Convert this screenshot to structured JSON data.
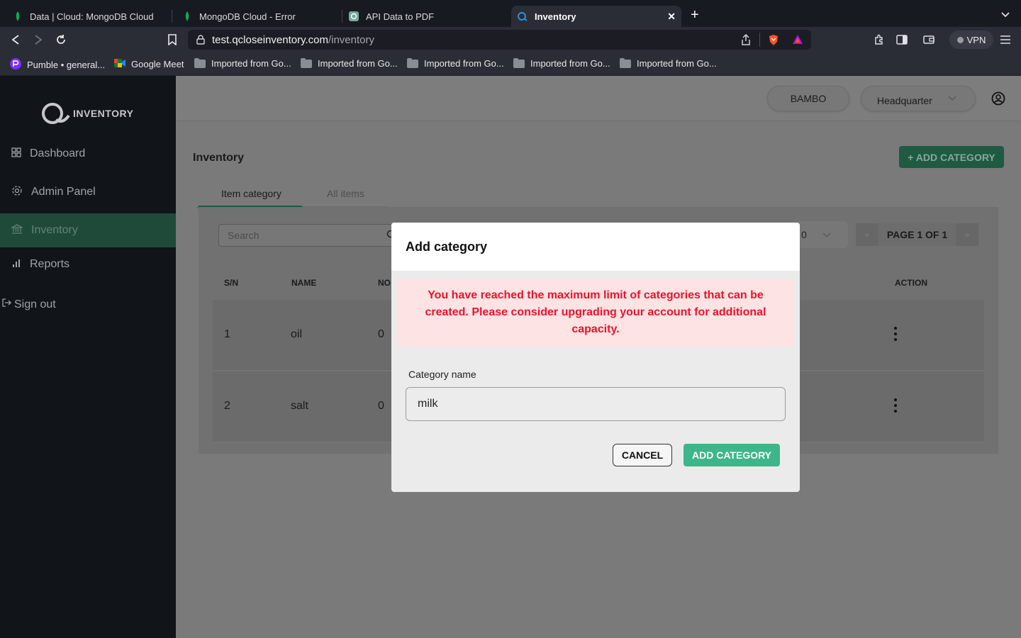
{
  "browser": {
    "tabs": [
      {
        "title": "Data | Cloud: MongoDB Cloud",
        "icon": "mongodb-leaf-icon"
      },
      {
        "title": "MongoDB Cloud - Error",
        "icon": "mongodb-leaf-icon"
      },
      {
        "title": "API Data to PDF",
        "icon": "chatgpt-icon"
      },
      {
        "title": "Inventory",
        "icon": "qclose-icon"
      }
    ],
    "url_host": "test.qcloseinventory.com",
    "url_path": "/inventory",
    "vpn_label": "VPN",
    "bookmarks": [
      {
        "label": "Pumble • general...",
        "icon": "pumble-icon"
      },
      {
        "label": "Google Meet",
        "icon": "google-meet-icon"
      },
      {
        "label": "Imported from Go...",
        "icon": "folder-icon"
      },
      {
        "label": "Imported from Go...",
        "icon": "folder-icon"
      },
      {
        "label": "Imported from Go...",
        "icon": "folder-icon"
      },
      {
        "label": "Imported from Go...",
        "icon": "folder-icon"
      },
      {
        "label": "Imported from Go...",
        "icon": "folder-icon"
      }
    ]
  },
  "sidebar": {
    "logo_text": "INVENTORY",
    "items": [
      {
        "label": "Dashboard",
        "icon": "grid-icon"
      },
      {
        "label": "Admin Panel",
        "icon": "gear-icon"
      },
      {
        "label": "Inventory",
        "icon": "bank-icon",
        "active": true
      },
      {
        "label": "Reports",
        "icon": "bar-chart-icon"
      }
    ],
    "signout": "Sign out"
  },
  "header": {
    "business": "BAMBO",
    "location": "Headquarter"
  },
  "page": {
    "title": "Inventory",
    "add_button": "+ ADD CATEGORY",
    "tabs": [
      "Item category",
      "All items"
    ],
    "search_placeholder": "Search",
    "per_page": "0",
    "pager_label": "PAGE 1 OF 1",
    "pager_prev": "«",
    "pager_next": "»",
    "columns": [
      "S/N",
      "NAME",
      "NO",
      "ACTION"
    ],
    "rows": [
      {
        "sn": "1",
        "name": "oil",
        "count": "0"
      },
      {
        "sn": "2",
        "name": "salt",
        "count": "0"
      }
    ]
  },
  "modal": {
    "title": "Add category",
    "alert": "You have reached the maximum limit of categories that can be created. Please consider upgrading your account for additional capacity.",
    "field_label": "Category name",
    "field_value": "milk",
    "cancel_label": "CANCEL",
    "submit_label": "ADD CATEGORY"
  },
  "colors": {
    "accent_green": "#3fb58b",
    "alert_red": "#e8142d",
    "sidebar_bg": "#111418"
  }
}
